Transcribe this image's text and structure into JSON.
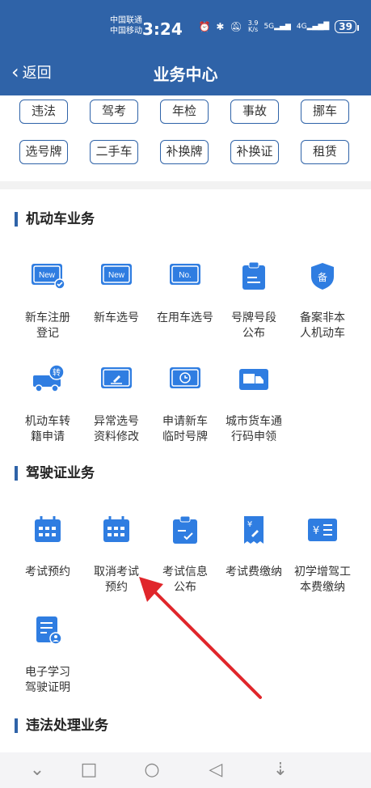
{
  "status_bar": {
    "carrier_1": "中国联通",
    "carrier_2": "中国移动",
    "time": "3:24",
    "net_speed_value": "3.9",
    "net_speed_unit": "K/s",
    "signal_label_1": "5G",
    "signal_label_2": "4G",
    "battery": "39"
  },
  "header": {
    "back_label": "返回",
    "title": "业务中心"
  },
  "shortcuts": [
    "违法",
    "驾考",
    "年检",
    "事故",
    "挪车",
    "选号牌",
    "二手车",
    "补换牌",
    "补换证",
    "租赁"
  ],
  "sections": {
    "motor": {
      "title": "机动车业务",
      "items": [
        {
          "label": "新车注册\n登记",
          "icon": "new-card-check-icon"
        },
        {
          "label": "新车选号",
          "icon": "new-plate-icon"
        },
        {
          "label": "在用车选号",
          "icon": "no-plate-icon"
        },
        {
          "label": "号牌号段\n公布",
          "icon": "clipboard-icon"
        },
        {
          "label": "备案非本\n人机动车",
          "icon": "shield-record-icon"
        },
        {
          "label": "机动车转\n籍申请",
          "icon": "truck-transfer-icon"
        },
        {
          "label": "异常选号\n资料修改",
          "icon": "edit-card-icon"
        },
        {
          "label": "申请新车\n临时号牌",
          "icon": "clock-card-icon"
        },
        {
          "label": "城市货车通\n行码申领",
          "icon": "delivery-truck-icon"
        }
      ]
    },
    "license": {
      "title": "驾驶证业务",
      "items": [
        {
          "label": "考试预约",
          "icon": "calendar-icon"
        },
        {
          "label": "取消考试\n预约",
          "icon": "calendar-cancel-icon"
        },
        {
          "label": "考试信息\n公布",
          "icon": "clipboard-check-icon"
        },
        {
          "label": "考试费缴纳",
          "icon": "fee-receipt-icon"
        },
        {
          "label": "初学增驾工\n本费缴纳",
          "icon": "yen-list-icon"
        },
        {
          "label": "电子学习\n驾驶证明",
          "icon": "document-user-icon"
        }
      ]
    },
    "violation": {
      "title": "违法处理业务"
    }
  },
  "colors": {
    "primary": "#2f63a8",
    "icon_blue": "#2f7de1",
    "annotation_red": "#e0262b"
  }
}
